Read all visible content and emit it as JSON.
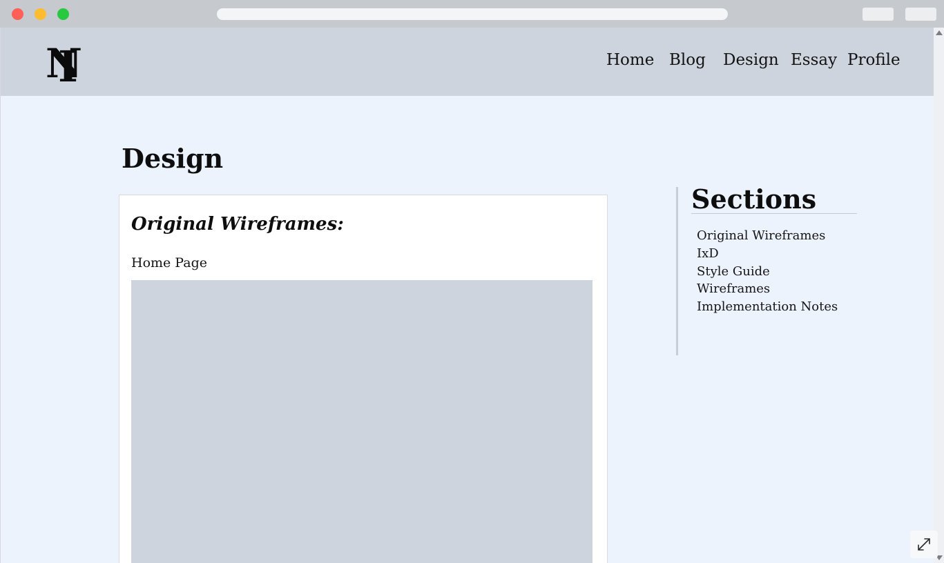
{
  "site": {
    "logo_text": "IN",
    "nav": {
      "home": "Home",
      "blog": "Blog",
      "design": "Design",
      "essay": "Essay",
      "profile": "Profile"
    }
  },
  "main": {
    "page_title": "Design",
    "card": {
      "heading": "Original Wireframes:",
      "subheading": "Home Page"
    }
  },
  "sidebar": {
    "title": "Sections",
    "items": [
      "Original Wireframes",
      "IxD",
      "Style Guide",
      "Wireframes",
      "Implementation Notes"
    ]
  },
  "icons": {
    "expand": "expand-icon",
    "scroll_up": "chevron-up-icon",
    "scroll_down": "chevron-down-icon"
  },
  "colors": {
    "header_bg": "#ced4dd",
    "page_bg": "#edf3fd",
    "card_bg": "#ffffff",
    "image_placeholder": "#ced4dd",
    "close": "#ff5f57",
    "minimize": "#febc2e",
    "maximize": "#28c840"
  }
}
